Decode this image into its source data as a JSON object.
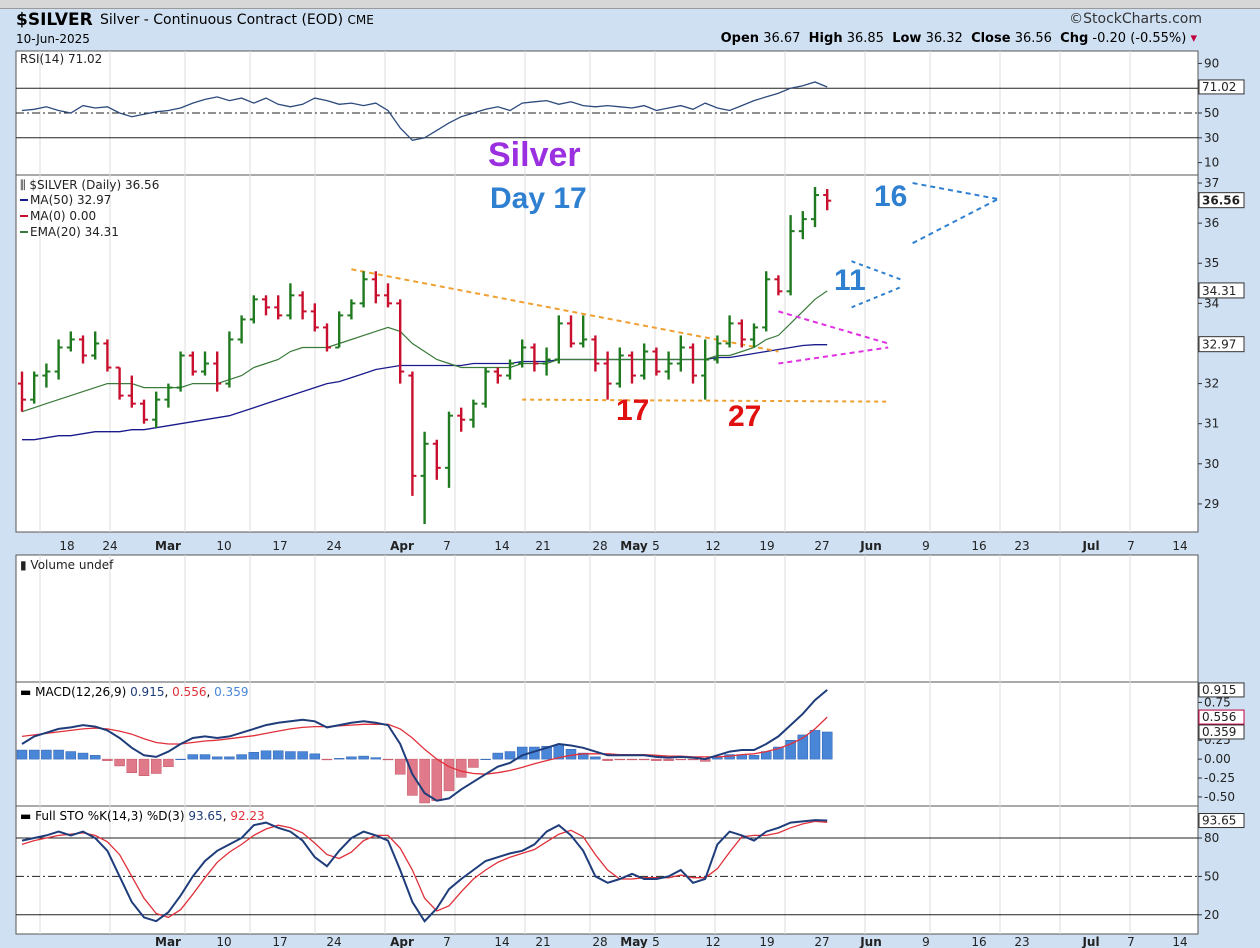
{
  "header": {
    "symbol": "$SILVER",
    "description": "Silver - Continuous Contract (EOD)",
    "exchange": "CME",
    "brand": "StockCharts.com",
    "date": "10-Jun-2025",
    "open_label": "Open",
    "open": "36.67",
    "high_label": "High",
    "high": "36.85",
    "low_label": "Low",
    "low": "36.32",
    "close_label": "Close",
    "close": "36.56",
    "chg_label": "Chg",
    "chg": "-0.20 (-0.55%)"
  },
  "colors": {
    "background": "#cfe0f3",
    "panel": "#ffffff",
    "up_bar": "#1f7a1f",
    "down_bar": "#c8102e",
    "ma50": "#1a1a8c",
    "ema20": "#3a7a3a",
    "rsi": "#2c4a7c",
    "macd": "#1f3d7a",
    "signal": "#e0303a",
    "histogram_pos": "#4a86d8",
    "histogram_neg": "#e07a8a",
    "annotation_purple": "#9a30e0",
    "annotation_blue": "#2f80d0",
    "annotation_red": "#e01010",
    "trendline_orange": "#f0a030",
    "pennant_magenta": "#e030e0"
  },
  "chart_data": [
    {
      "panel": "rsi",
      "type": "line",
      "legend": "RSI(14) 71.02",
      "ylim": [
        0,
        100
      ],
      "ticks": [
        "90",
        "50",
        "30",
        "10"
      ],
      "reference_lines": [
        70,
        50,
        30
      ],
      "last_value": "71.02",
      "values": [
        52,
        53,
        55,
        52,
        50,
        56,
        54,
        55,
        50,
        47,
        49,
        51,
        52,
        54,
        58,
        61,
        63,
        60,
        62,
        58,
        62,
        57,
        55,
        57,
        62,
        60,
        57,
        58,
        56,
        58,
        52,
        38,
        28,
        30,
        36,
        42,
        47,
        50,
        53,
        55,
        52,
        58,
        59,
        60,
        57,
        59,
        56,
        55,
        56,
        55,
        54,
        56,
        52,
        54,
        56,
        53,
        58,
        54,
        52,
        56,
        60,
        63,
        66,
        70,
        72,
        75,
        71
      ]
    },
    {
      "panel": "price",
      "type": "ohlc",
      "legend": "$SILVER (Daily) 36.56",
      "ylim": [
        28.3,
        37.2
      ],
      "ticks": [
        "37",
        "36",
        "35",
        "34",
        "32",
        "31",
        "30",
        "29"
      ],
      "last_label": "36.56",
      "x_ticks": [
        "18",
        "24",
        "Mar",
        "10",
        "17",
        "24",
        "Apr",
        "7",
        "14",
        "21",
        "28",
        "May",
        "5",
        "12",
        "19",
        "27",
        "Jun",
        "9",
        "16",
        "23",
        "Jul",
        "7",
        "14"
      ],
      "ohlc": [
        [
          32.0,
          32.3,
          31.3,
          31.6
        ],
        [
          31.6,
          32.3,
          31.5,
          32.2
        ],
        [
          32.2,
          32.5,
          31.9,
          32.3
        ],
        [
          32.3,
          33.1,
          32.1,
          32.9
        ],
        [
          32.9,
          33.3,
          32.8,
          33.1
        ],
        [
          33.1,
          33.2,
          32.5,
          32.7
        ],
        [
          32.7,
          33.3,
          32.6,
          33.0
        ],
        [
          33.0,
          33.1,
          32.3,
          32.4
        ],
        [
          32.4,
          32.4,
          31.6,
          31.7
        ],
        [
          31.7,
          32.2,
          31.4,
          31.5
        ],
        [
          31.5,
          31.6,
          31.0,
          31.1
        ],
        [
          31.1,
          31.8,
          30.9,
          31.6
        ],
        [
          31.6,
          32.0,
          31.4,
          31.9
        ],
        [
          31.9,
          32.8,
          31.8,
          32.7
        ],
        [
          32.7,
          32.8,
          32.2,
          32.3
        ],
        [
          32.3,
          32.8,
          32.2,
          32.5
        ],
        [
          32.5,
          32.8,
          31.8,
          32.0
        ],
        [
          32.0,
          33.3,
          31.9,
          33.1
        ],
        [
          33.1,
          33.7,
          33.0,
          33.6
        ],
        [
          33.6,
          34.2,
          33.5,
          34.1
        ],
        [
          34.1,
          34.2,
          33.7,
          33.9
        ],
        [
          33.9,
          34.2,
          33.6,
          33.7
        ],
        [
          33.7,
          34.5,
          33.6,
          34.2
        ],
        [
          34.2,
          34.3,
          33.6,
          33.8
        ],
        [
          33.8,
          34.0,
          33.3,
          33.4
        ],
        [
          33.4,
          33.5,
          32.8,
          32.9
        ],
        [
          32.9,
          33.8,
          32.9,
          33.7
        ],
        [
          33.7,
          34.1,
          33.6,
          34.0
        ],
        [
          34.0,
          34.8,
          33.9,
          34.6
        ],
        [
          34.6,
          34.8,
          34.0,
          34.2
        ],
        [
          34.2,
          34.5,
          33.9,
          34.0
        ],
        [
          34.0,
          34.1,
          32.0,
          32.3
        ],
        [
          32.2,
          32.3,
          29.2,
          29.7
        ],
        [
          29.7,
          30.8,
          28.5,
          30.5
        ],
        [
          30.5,
          30.6,
          29.6,
          29.9
        ],
        [
          29.9,
          31.3,
          29.4,
          31.2
        ],
        [
          31.2,
          31.4,
          30.8,
          31.1
        ],
        [
          31.1,
          31.6,
          30.9,
          31.5
        ],
        [
          31.5,
          32.4,
          31.4,
          32.3
        ],
        [
          32.3,
          32.4,
          32.0,
          32.2
        ],
        [
          32.2,
          32.6,
          32.1,
          32.5
        ],
        [
          32.5,
          33.1,
          32.4,
          32.9
        ],
        [
          32.9,
          33.0,
          32.3,
          32.5
        ],
        [
          32.5,
          32.9,
          32.2,
          32.6
        ],
        [
          32.6,
          33.7,
          32.5,
          33.5
        ],
        [
          33.5,
          33.7,
          32.9,
          33.0
        ],
        [
          33.0,
          33.7,
          32.9,
          33.1
        ],
        [
          33.1,
          33.2,
          32.3,
          32.5
        ],
        [
          32.5,
          32.8,
          31.6,
          32.0
        ],
        [
          32.0,
          32.9,
          31.9,
          32.7
        ],
        [
          32.7,
          32.8,
          32.0,
          32.2
        ],
        [
          32.2,
          33.0,
          32.1,
          32.8
        ],
        [
          32.8,
          32.9,
          32.2,
          32.3
        ],
        [
          32.3,
          32.8,
          32.1,
          32.5
        ],
        [
          32.5,
          33.2,
          32.3,
          32.9
        ],
        [
          32.9,
          33.0,
          32.0,
          32.2
        ],
        [
          32.2,
          33.1,
          31.6,
          32.6
        ],
        [
          32.6,
          33.2,
          32.5,
          33.0
        ],
        [
          33.0,
          33.7,
          32.9,
          33.5
        ],
        [
          33.5,
          33.6,
          32.9,
          33.1
        ],
        [
          33.1,
          33.5,
          32.9,
          33.4
        ],
        [
          33.4,
          34.8,
          33.3,
          34.6
        ],
        [
          34.6,
          34.7,
          34.2,
          34.3
        ],
        [
          34.3,
          36.2,
          34.2,
          35.8
        ],
        [
          35.8,
          36.3,
          35.6,
          36.1
        ],
        [
          36.1,
          36.9,
          35.9,
          36.7
        ],
        [
          36.7,
          36.85,
          36.32,
          36.56
        ]
      ],
      "series": [
        {
          "name": "MA(50)",
          "legend": "MA(50) 32.97",
          "values": [
            30.6,
            30.6,
            30.65,
            30.7,
            30.7,
            30.75,
            30.8,
            30.8,
            30.8,
            30.85,
            30.85,
            30.9,
            30.95,
            31.0,
            31.05,
            31.1,
            31.15,
            31.2,
            31.3,
            31.4,
            31.5,
            31.6,
            31.7,
            31.8,
            31.9,
            32.0,
            32.05,
            32.15,
            32.25,
            32.35,
            32.4,
            32.45,
            32.45,
            32.45,
            32.45,
            32.45,
            32.45,
            32.5,
            32.5,
            32.5,
            32.5,
            32.55,
            32.55,
            32.55,
            32.6,
            32.6,
            32.6,
            32.6,
            32.6,
            32.6,
            32.6,
            32.6,
            32.6,
            32.6,
            32.6,
            32.6,
            32.6,
            32.65,
            32.65,
            32.7,
            32.75,
            32.8,
            32.85,
            32.9,
            32.95,
            32.97,
            32.97
          ]
        },
        {
          "name": "MA(0)",
          "legend": "MA(0) 0.00",
          "values": []
        },
        {
          "name": "EMA(20)",
          "legend": "EMA(20) 34.31",
          "values": [
            31.3,
            31.4,
            31.5,
            31.6,
            31.7,
            31.8,
            31.9,
            32.0,
            32.0,
            32.0,
            31.9,
            31.9,
            31.9,
            31.9,
            32.0,
            32.0,
            32.0,
            32.1,
            32.2,
            32.4,
            32.5,
            32.6,
            32.8,
            32.9,
            32.9,
            32.9,
            33.0,
            33.1,
            33.2,
            33.3,
            33.4,
            33.3,
            33.0,
            32.8,
            32.6,
            32.5,
            32.4,
            32.4,
            32.4,
            32.4,
            32.4,
            32.5,
            32.5,
            32.5,
            32.6,
            32.6,
            32.6,
            32.6,
            32.6,
            32.6,
            32.6,
            32.6,
            32.6,
            32.6,
            32.6,
            32.6,
            32.6,
            32.7,
            32.7,
            32.8,
            32.9,
            33.1,
            33.2,
            33.5,
            33.8,
            34.1,
            34.31
          ]
        }
      ],
      "annotations": {
        "title": "Silver",
        "subtitle": "Day 17",
        "labels": [
          "16",
          "11",
          "17",
          "27"
        ]
      }
    },
    {
      "panel": "volume",
      "type": "bar",
      "legend": "Volume undef",
      "values": []
    },
    {
      "panel": "macd",
      "type": "line",
      "legend": "MACD(12,26,9)",
      "legend_macd": "0.915",
      "legend_signal": "0.556",
      "legend_hist": "0.359",
      "ylim": [
        -0.62,
        1.02
      ],
      "ticks": [
        "0.75",
        "0.25",
        "0.00",
        "-0.25",
        "-0.50"
      ],
      "last_macd": "0.915",
      "last_signal": "0.556",
      "last_hist": "0.359",
      "series": [
        {
          "name": "MACD",
          "values": [
            0.2,
            0.3,
            0.35,
            0.4,
            0.42,
            0.45,
            0.43,
            0.38,
            0.28,
            0.15,
            0.05,
            0.03,
            0.1,
            0.2,
            0.28,
            0.3,
            0.28,
            0.3,
            0.35,
            0.4,
            0.45,
            0.48,
            0.5,
            0.52,
            0.5,
            0.42,
            0.45,
            0.48,
            0.5,
            0.48,
            0.45,
            0.2,
            -0.2,
            -0.45,
            -0.55,
            -0.52,
            -0.4,
            -0.3,
            -0.2,
            -0.1,
            -0.05,
            0.05,
            0.1,
            0.15,
            0.2,
            0.18,
            0.15,
            0.1,
            0.05,
            0.05,
            0.05,
            0.05,
            0.03,
            0.02,
            0.03,
            0.02,
            0.0,
            0.05,
            0.1,
            0.12,
            0.12,
            0.2,
            0.3,
            0.45,
            0.6,
            0.78,
            0.915
          ]
        },
        {
          "name": "Signal",
          "values": [
            0.3,
            0.32,
            0.34,
            0.36,
            0.38,
            0.4,
            0.41,
            0.4,
            0.37,
            0.33,
            0.27,
            0.22,
            0.2,
            0.2,
            0.22,
            0.24,
            0.25,
            0.27,
            0.29,
            0.31,
            0.34,
            0.37,
            0.4,
            0.42,
            0.43,
            0.43,
            0.44,
            0.45,
            0.46,
            0.46,
            0.46,
            0.4,
            0.28,
            0.13,
            0.0,
            -0.1,
            -0.16,
            -0.19,
            -0.2,
            -0.18,
            -0.15,
            -0.11,
            -0.06,
            -0.02,
            0.02,
            0.05,
            0.07,
            0.07,
            0.07,
            0.06,
            0.06,
            0.06,
            0.05,
            0.04,
            0.04,
            0.03,
            0.03,
            0.03,
            0.04,
            0.06,
            0.07,
            0.1,
            0.14,
            0.2,
            0.28,
            0.4,
            0.556
          ]
        },
        {
          "name": "Histogram",
          "values": [
            0.12,
            0.12,
            0.12,
            0.12,
            0.1,
            0.08,
            0.05,
            -0.02,
            -0.09,
            -0.18,
            -0.22,
            -0.19,
            -0.1,
            0.0,
            0.06,
            0.06,
            0.03,
            0.03,
            0.06,
            0.09,
            0.11,
            0.11,
            0.1,
            0.1,
            0.07,
            -0.01,
            0.01,
            0.03,
            0.04,
            0.02,
            -0.01,
            -0.2,
            -0.48,
            -0.58,
            -0.55,
            -0.42,
            -0.24,
            -0.11,
            0.0,
            0.08,
            0.1,
            0.16,
            0.16,
            0.17,
            0.18,
            0.13,
            0.08,
            0.03,
            -0.02,
            -0.01,
            -0.01,
            -0.01,
            -0.02,
            -0.02,
            -0.01,
            -0.01,
            -0.03,
            0.02,
            0.06,
            0.06,
            0.05,
            0.1,
            0.16,
            0.25,
            0.32,
            0.38,
            0.359
          ]
        }
      ]
    },
    {
      "panel": "stochastic",
      "type": "line",
      "legend": "Full STO %K(14,3) %D(3)",
      "legend_k": "93.65",
      "legend_d": "92.23",
      "ylim": [
        5,
        105
      ],
      "ticks": [
        "80",
        "50",
        "20"
      ],
      "reference_lines": [
        80,
        50,
        20
      ],
      "last_label": "93.65",
      "series": [
        {
          "name": "%K",
          "values": [
            78,
            80,
            82,
            85,
            82,
            85,
            80,
            70,
            50,
            30,
            18,
            15,
            22,
            35,
            50,
            62,
            70,
            75,
            80,
            90,
            92,
            88,
            85,
            78,
            65,
            58,
            70,
            80,
            85,
            82,
            78,
            55,
            30,
            15,
            25,
            40,
            48,
            55,
            62,
            65,
            68,
            70,
            75,
            85,
            90,
            82,
            70,
            50,
            45,
            48,
            52,
            48,
            48,
            50,
            55,
            45,
            48,
            75,
            85,
            82,
            78,
            85,
            88,
            92,
            93,
            94,
            93.65
          ]
        },
        {
          "name": "%D",
          "values": [
            75,
            78,
            80,
            82,
            83,
            84,
            82,
            77,
            67,
            50,
            33,
            21,
            18,
            24,
            36,
            49,
            61,
            69,
            75,
            82,
            87,
            90,
            88,
            84,
            76,
            67,
            64,
            69,
            78,
            82,
            82,
            72,
            55,
            33,
            23,
            27,
            38,
            48,
            55,
            61,
            65,
            68,
            71,
            77,
            83,
            86,
            81,
            67,
            55,
            48,
            48,
            49,
            49,
            49,
            51,
            49,
            49,
            56,
            69,
            81,
            82,
            82,
            84,
            88,
            91,
            93,
            92.23
          ]
        }
      ]
    }
  ]
}
